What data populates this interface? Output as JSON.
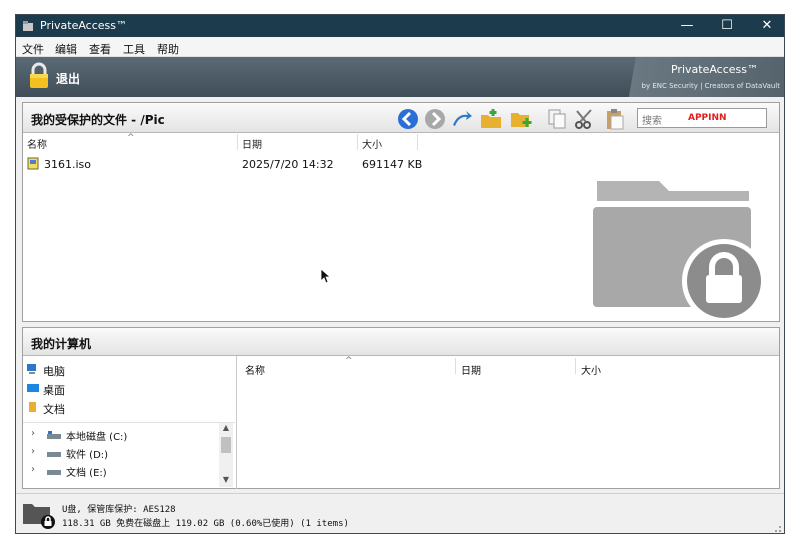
{
  "window": {
    "title": "PrivateAccess™",
    "controls": {
      "minimize": "—",
      "maximize": "☐",
      "close": "✕"
    }
  },
  "menu": [
    "文件",
    "编辑",
    "查看",
    "工具",
    "帮助"
  ],
  "toolbar": {
    "exit_label": "退出",
    "brand_name": "PrivateAccess™",
    "brand_sub": "by ENC Security | Creators of DataVault"
  },
  "vault_panel": {
    "title": "我的受保护的文件 - /Pic",
    "search_placeholder": "搜索",
    "watermark": "APPINN",
    "columns": [
      "名称",
      "日期",
      "大小"
    ],
    "files": [
      {
        "name": "3161.iso",
        "date": "2025/7/20 14:32",
        "size": "691147 KB"
      }
    ]
  },
  "computer_panel": {
    "title": "我的计算机",
    "tree": [
      {
        "label": "电脑",
        "icon": "computer-icon"
      },
      {
        "label": "桌面",
        "icon": "desktop-icon"
      },
      {
        "label": "文档",
        "icon": "documents-icon"
      }
    ],
    "drives": [
      {
        "label": "本地磁盘 (C:)"
      },
      {
        "label": "软件 (D:)"
      },
      {
        "label": "文档 (E:)"
      }
    ],
    "columns": [
      "名称",
      "日期",
      "大小"
    ]
  },
  "status": {
    "line1": "U盘, 保管库保护: AES128",
    "line2": "118.31 GB 免费在磁盘上 119.02 GB (0.60%已使用) (1 items)"
  },
  "colors": {
    "titlebar": "#1c3b4c",
    "header_band": "#4a5963",
    "watermark": "#e02020"
  }
}
